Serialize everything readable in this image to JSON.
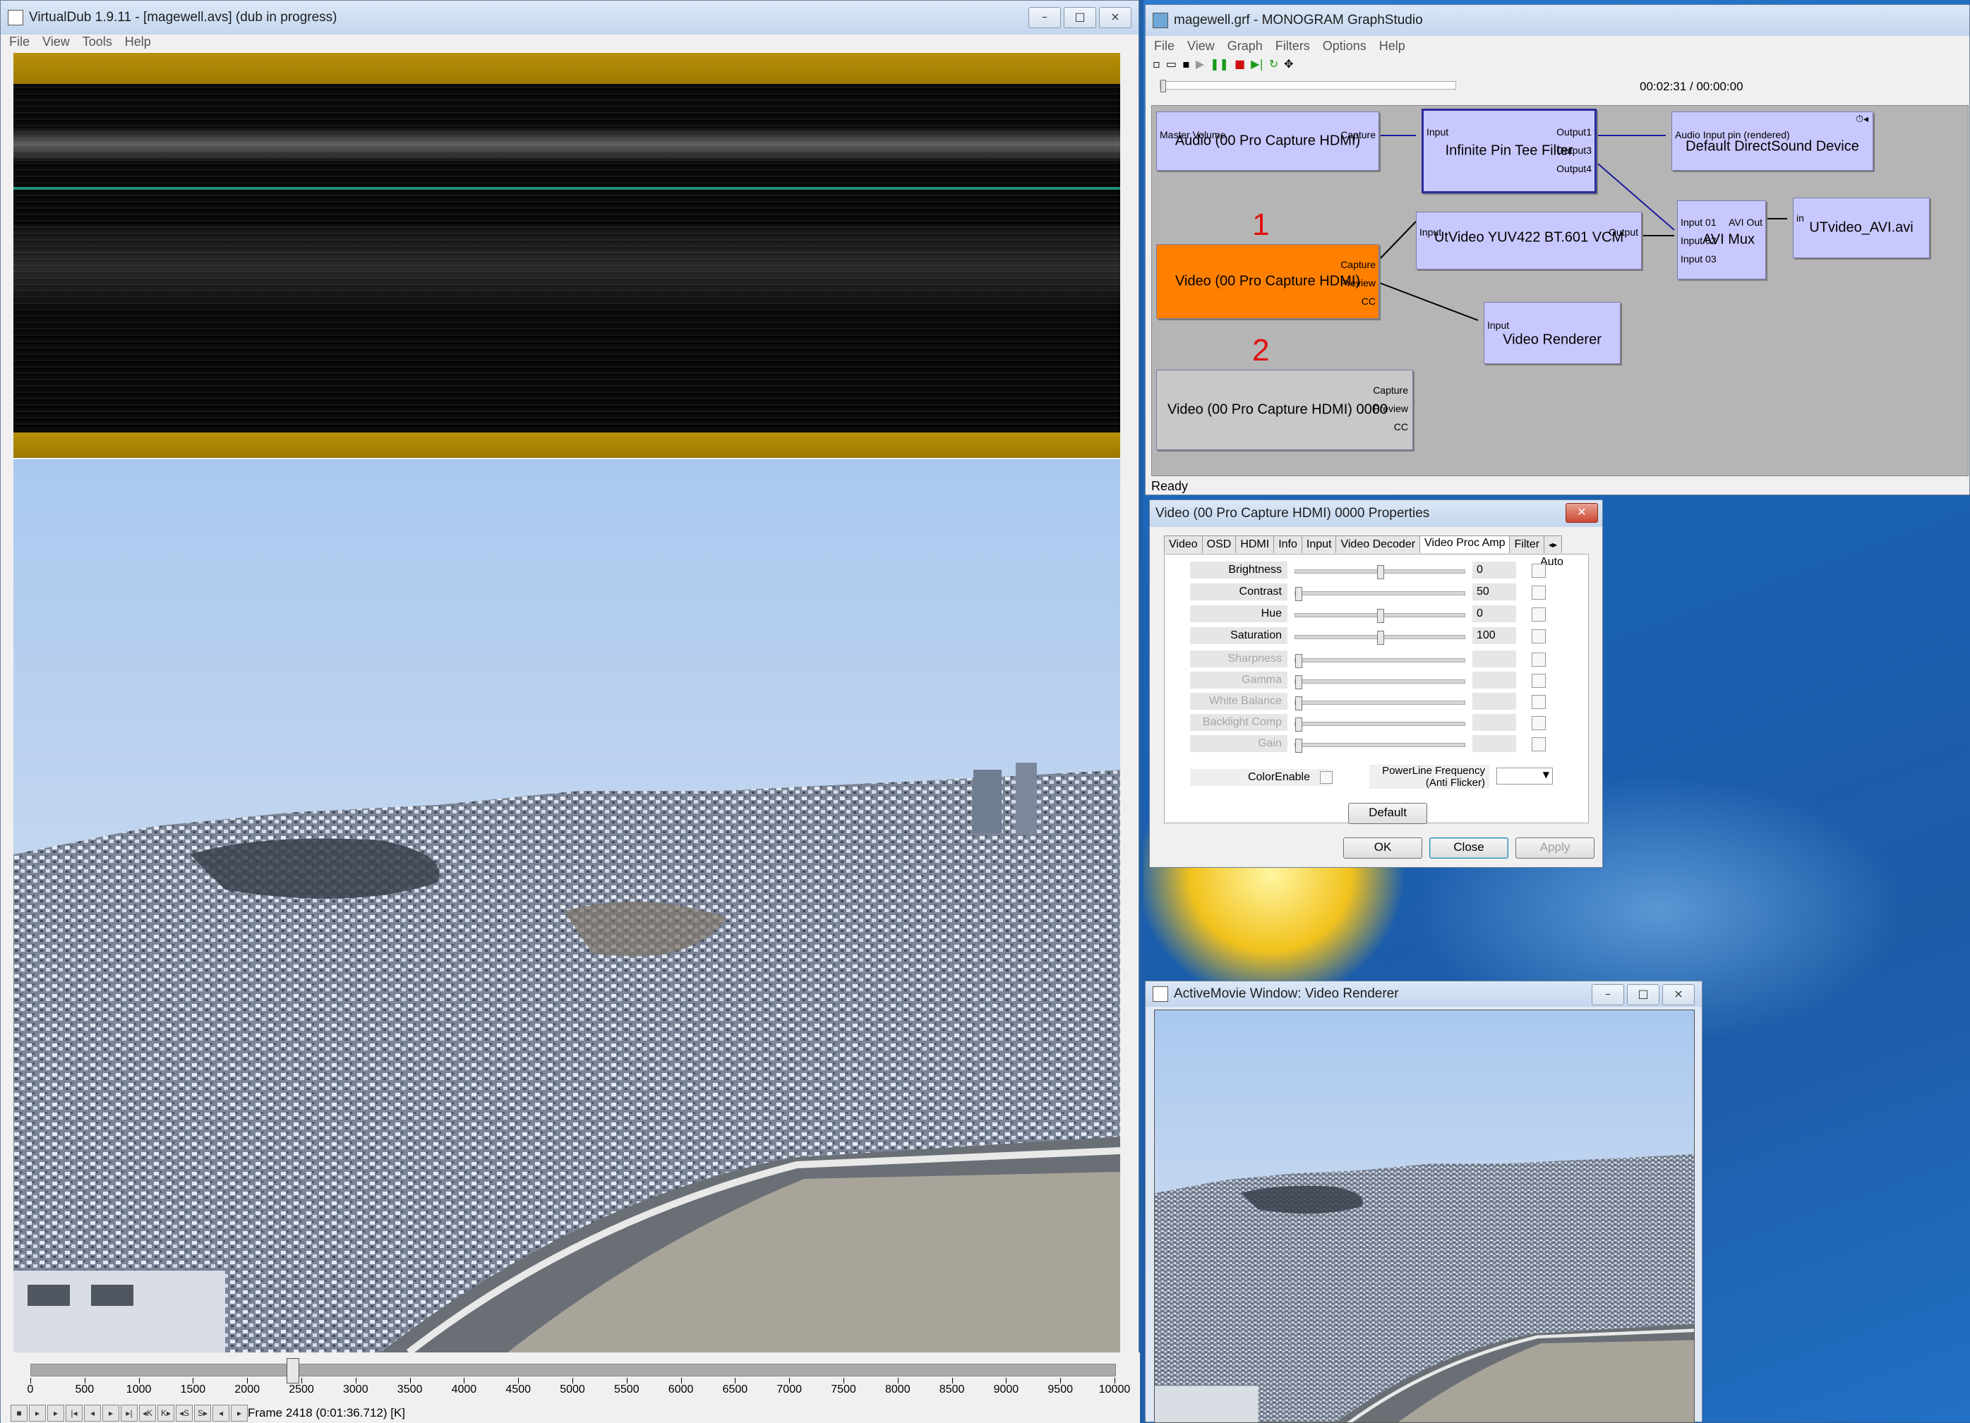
{
  "virtualdub": {
    "title": "VirtualDub 1.9.11 - [magewell.avs] (dub in progress)",
    "menu": [
      "File",
      "View",
      "Tools",
      "Help"
    ],
    "timeline_ticks": [
      "0",
      "500",
      "1000",
      "1500",
      "2000",
      "2500",
      "3000",
      "3500",
      "4000",
      "4500",
      "5000",
      "5500",
      "6000",
      "6500",
      "7000",
      "7500",
      "8000",
      "8500",
      "9000",
      "9500",
      "10000"
    ],
    "timeline_position": 0.2418,
    "frame_status": "Frame 2418 (0:01:36.712) [K]"
  },
  "graphstudio": {
    "title": "magewell.grf - MONOGRAM GraphStudio",
    "menu": [
      "File",
      "View",
      "Graph",
      "Filters",
      "Options",
      "Help"
    ],
    "time": "00:02:31 / 00:00:00",
    "status": "Ready",
    "annotations": [
      "1",
      "2"
    ],
    "filters": {
      "audio": {
        "name": "Audio (00 Pro Capture HDMI)",
        "pins": [
          "Master Volume",
          "Capture"
        ]
      },
      "tee": {
        "name": "Infinite Pin Tee Filter",
        "pins": [
          "Input",
          "Output1",
          "Output3",
          "Output4"
        ]
      },
      "dsound": {
        "name": "Default DirectSound Device",
        "pins": [
          "Audio Input pin (rendered)"
        ]
      },
      "video1": {
        "name": "Video (00 Pro Capture HDMI)",
        "pins": [
          "Capture",
          "Preview",
          "CC"
        ]
      },
      "utvideo": {
        "name": "UtVideo YUV422 BT.601 VCM",
        "pins": [
          "Input",
          "Output"
        ]
      },
      "avimux": {
        "name": "AVI Mux",
        "pins": [
          "Input 01",
          "Input 02",
          "Input 03",
          "AVI Out"
        ]
      },
      "avifile": {
        "name": "UTvideo_AVI.avi",
        "pins": [
          "in"
        ]
      },
      "renderer": {
        "name": "Video Renderer",
        "pins": [
          "Input"
        ]
      },
      "video2": {
        "name": "Video (00 Pro Capture HDMI) 0000",
        "pins": [
          "Capture",
          "Preview",
          "CC"
        ]
      }
    }
  },
  "props": {
    "title": "Video (00 Pro Capture HDMI) 0000 Properties",
    "tabs": [
      "Video",
      "OSD",
      "HDMI",
      "Info",
      "Input",
      "Video Decoder",
      "Video Proc Amp",
      "Filter"
    ],
    "active_tab": "Video Proc Amp",
    "auto_label": "Auto",
    "rows": [
      {
        "label": "Brightness",
        "value": "0",
        "pos": 0.5,
        "enabled": true
      },
      {
        "label": "Contrast",
        "value": "50",
        "pos": 0.0,
        "enabled": true
      },
      {
        "label": "Hue",
        "value": "0",
        "pos": 0.5,
        "enabled": true
      },
      {
        "label": "Saturation",
        "value": "100",
        "pos": 0.5,
        "enabled": true
      },
      {
        "label": "Sharpness",
        "value": "",
        "pos": 0.0,
        "enabled": false
      },
      {
        "label": "Gamma",
        "value": "",
        "pos": 0.0,
        "enabled": false
      },
      {
        "label": "White Balance",
        "value": "",
        "pos": 0.0,
        "enabled": false
      },
      {
        "label": "Backlight Comp",
        "value": "",
        "pos": 0.0,
        "enabled": false
      },
      {
        "label": "Gain",
        "value": "",
        "pos": 0.0,
        "enabled": false
      }
    ],
    "color_enable": "ColorEnable",
    "powerline_1": "PowerLine Frequency",
    "powerline_2": "(Anti Flicker)",
    "default_btn": "Default",
    "ok_btn": "OK",
    "close_btn": "Close",
    "apply_btn": "Apply"
  },
  "activemovie": {
    "title": "ActiveMovie Window: Video Renderer"
  },
  "colors": {
    "selected_filter": "#ff8000",
    "filter_fill": "#c8c8ff",
    "gold_stripe": "#b8900a",
    "annotation_red": "#e01010"
  }
}
